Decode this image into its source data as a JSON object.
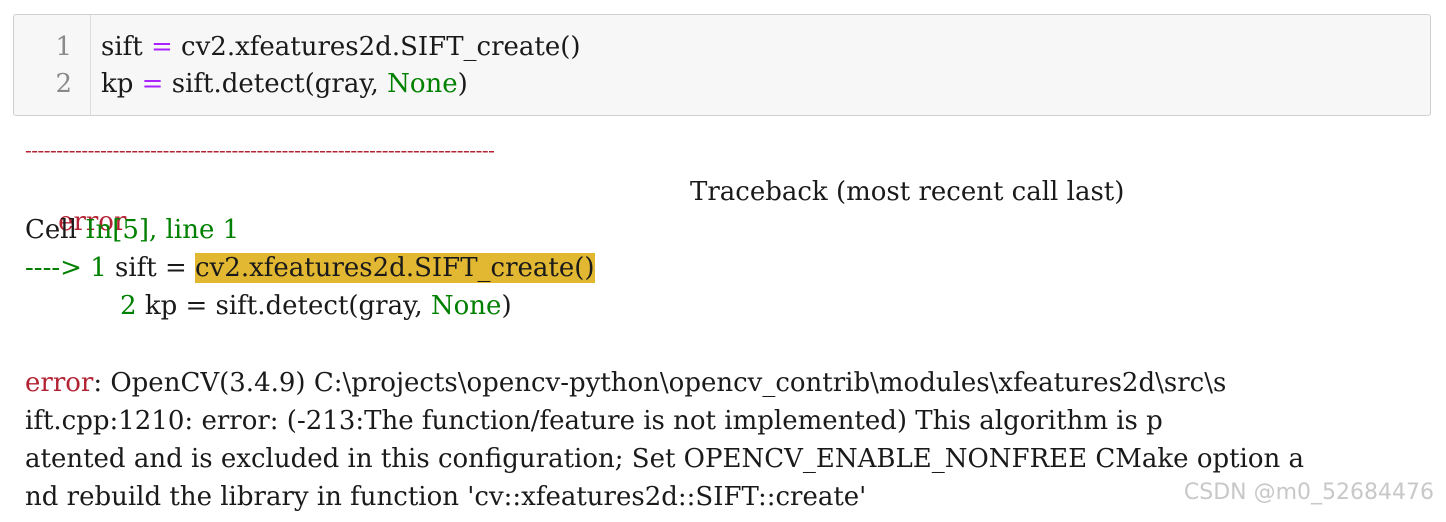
{
  "cell": {
    "line_numbers": [
      "1",
      "2"
    ],
    "line1": {
      "a": "sift ",
      "op": "=",
      "b": " cv2.xfeatures2d.SIFT_create()"
    },
    "line2": {
      "a": "kp ",
      "op": "=",
      "b": " sift.detect(gray, ",
      "kw": "None",
      "c": ")"
    }
  },
  "output": {
    "separator": "---------------------------------------------------------------------------",
    "error_name": "error",
    "traceback_header": "Traceback (most recent call last)",
    "cell_prefix": "Cell ",
    "cell_ref": "In[5], line 1",
    "arrow": "----> 1 ",
    "tb_line1_pre": "sift = ",
    "tb_line1_hl": "cv2.xfeatures2d.SIFT_create()",
    "tb_line2_num": "2 ",
    "tb_line2_pre": "kp = sift.detect(gray, ",
    "tb_line2_kw": "None",
    "tb_line2_post": ")",
    "message_lines": [
      ": OpenCV(3.4.9) C:\\projects\\opencv-python\\opencv_contrib\\modules\\xfeatures2d\\src\\s",
      "ift.cpp:1210: error: (-213:The function/feature is not implemented) This algorithm is p",
      "atented and is excluded in this configuration; Set OPENCV_ENABLE_NONFREE CMake option a",
      "nd rebuild the library in function 'cv::xfeatures2d::SIFT::create'"
    ]
  },
  "watermark": "CSDN @m0_52684476"
}
